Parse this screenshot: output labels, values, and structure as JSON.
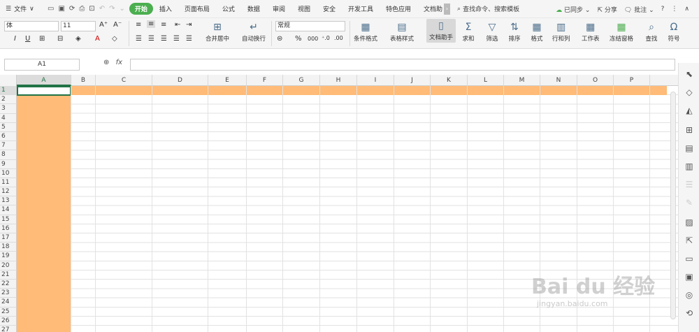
{
  "menubar": {
    "file_label": "文件",
    "tabs": [
      "开始",
      "插入",
      "页面布局",
      "公式",
      "数据",
      "审阅",
      "视图",
      "安全",
      "开发工具",
      "特色应用",
      "文档助"
    ],
    "search_label": "查找命令、搜索模板",
    "sync_label": "已同步",
    "share_label": "分享",
    "comment_label": "批注"
  },
  "ribbon": {
    "font_name": "体",
    "font_size": "11",
    "number_format": "常规",
    "buttons": {
      "merge_center": "合并居中",
      "wrap_text": "自动换行",
      "cond_format": "条件格式",
      "table_style": "表格样式",
      "doc_assistant": "文档助手",
      "sum": "求和",
      "filter": "筛选",
      "sort": "排序",
      "format": "格式",
      "row_col": "行和列",
      "worksheet": "工作表",
      "freeze": "冻结窗格",
      "find": "查找",
      "symbol": "符号"
    },
    "percent": "%",
    "thousands": "000"
  },
  "formula_bar": {
    "name_box": "A1",
    "fx": "fx"
  },
  "grid": {
    "columns": [
      "A",
      "B",
      "C",
      "D",
      "E",
      "F",
      "G",
      "H",
      "I",
      "J",
      "K",
      "L",
      "M",
      "N",
      "O",
      "P"
    ],
    "rows": [
      "1",
      "2",
      "3",
      "4",
      "5",
      "6",
      "7",
      "8",
      "9",
      "10",
      "11",
      "12",
      "13",
      "14",
      "15",
      "16",
      "17",
      "18",
      "19",
      "20",
      "21",
      "22",
      "23",
      "24",
      "25",
      "26",
      "27"
    ],
    "selected_cell": "A1",
    "highlight_color": "#ffbb77"
  },
  "watermark": {
    "line1": "Bai du 经验",
    "line2": "jingyan.baidu.com"
  }
}
